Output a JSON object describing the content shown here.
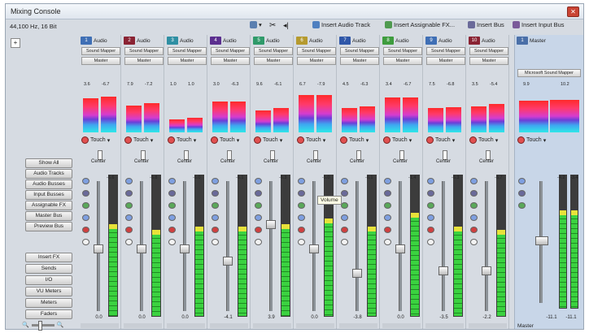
{
  "window": {
    "title": "Mixing Console",
    "format": "44,100 Hz, 16 Bit"
  },
  "toolbar": {
    "insert_audio_track": "Insert Audio Track",
    "insert_assignable_fx": "Insert Assignable FX...",
    "insert_bus": "Insert Bus",
    "insert_input_bus": "Insert Input Bus"
  },
  "left_panel": {
    "plus": "+",
    "view_buttons": [
      "Show All",
      "Audio Tracks",
      "Audio Busses",
      "Input Busses",
      "Assignable FX",
      "Master Bus",
      "Preview Bus"
    ],
    "section_buttons": [
      "Insert FX",
      "Sends",
      "I/O",
      "VU Meters",
      "Meters",
      "Faders"
    ]
  },
  "strip_defaults": {
    "send_label": "Sound Mapper",
    "output": "Master",
    "automation": "Touch",
    "pan": "Center"
  },
  "strips": [
    {
      "num": "1",
      "name": "Audio",
      "color": "#3f6fb5",
      "peak_l": "3.6",
      "peak_r": "-6.7",
      "meter_l": 0.78,
      "meter_r": 0.82,
      "fader": 0.48,
      "vu_peak": "-6.6",
      "vu": 0.62,
      "vol": "0.0"
    },
    {
      "num": "2",
      "name": "Audio",
      "color": "#8a2333",
      "peak_l": "7.9",
      "peak_r": "-7.2",
      "meter_l": 0.62,
      "meter_r": 0.66,
      "fader": 0.48,
      "vu_peak": "-6.8",
      "vu": 0.58,
      "vol": "0.0"
    },
    {
      "num": "3",
      "name": "Audio",
      "color": "#2f8fa3",
      "peak_l": "1.0",
      "peak_r": "1.0",
      "meter_l": 0.3,
      "meter_r": 0.34,
      "fader": 0.48,
      "vu_peak": "-6.0",
      "vu": 0.6,
      "vol": "0.0"
    },
    {
      "num": "4",
      "name": "Audio",
      "color": "#5b2f8f",
      "peak_l": "3.0",
      "peak_r": "-6.3",
      "meter_l": 0.7,
      "meter_r": 0.7,
      "fader": 0.38,
      "vu_peak": "-6.1",
      "vu": 0.6,
      "vol": "-4.1"
    },
    {
      "num": "5",
      "name": "Audio",
      "color": "#2f9a6a",
      "peak_l": "9.6",
      "peak_r": "-6.1",
      "meter_l": 0.5,
      "meter_r": 0.55,
      "fader": 0.68,
      "vu_peak": "-6.3",
      "vu": 0.62,
      "vol": "3.9"
    },
    {
      "num": "6",
      "name": "Audio",
      "color": "#b59a2f",
      "peak_l": "6.7",
      "peak_r": "-7.9",
      "meter_l": 0.86,
      "meter_r": 0.86,
      "fader": 0.48,
      "vu_peak": "-5.0",
      "vu": 0.66,
      "vol": "0.0"
    },
    {
      "num": "7",
      "name": "Audio",
      "color": "#2f57a8",
      "peak_l": "4.5",
      "peak_r": "-6.3",
      "meter_l": 0.55,
      "meter_r": 0.6,
      "fader": 0.28,
      "vu_peak": "-6.1",
      "vu": 0.6,
      "vol": "-3.8"
    },
    {
      "num": "8",
      "name": "Audio",
      "color": "#3e9c3e",
      "peak_l": "3.4",
      "peak_r": "-6.7",
      "meter_l": 0.8,
      "meter_r": 0.8,
      "fader": 0.48,
      "vu_peak": "-1.4",
      "vu": 0.7,
      "vol": "0.0"
    },
    {
      "num": "9",
      "name": "Audio",
      "color": "#3f6fb5",
      "peak_l": "7.5",
      "peak_r": "-6.8",
      "meter_l": 0.56,
      "meter_r": 0.58,
      "fader": 0.3,
      "vu_peak": "-6.3",
      "vu": 0.6,
      "vol": "-3.5"
    },
    {
      "num": "10",
      "name": "Audio",
      "color": "#8a2333",
      "peak_l": "3.5",
      "peak_r": "-5.4",
      "meter_l": 0.6,
      "meter_r": 0.64,
      "fader": 0.3,
      "vu_peak": "-6.7",
      "vu": 0.58,
      "vol": "-2.2"
    }
  ],
  "master": {
    "num": "1",
    "name": "Master",
    "color": "#4a6fa8",
    "send_label": "Microsoft Sound Mapper",
    "peak_l": "9.9",
    "peak_r": "10.2",
    "meter_l": 0.72,
    "meter_r": 0.74,
    "automation": "Touch",
    "fader": 0.55,
    "vu_peak_l": "-4.2",
    "vu_peak_r": "-3.4",
    "vu": 0.7,
    "vol_l": "-11.1",
    "vol_r": "-11.1",
    "footer": "Master"
  },
  "tooltip": "Volume",
  "colors": {
    "accent": "#3f6fb5",
    "meter_hot": "#ff2a2a",
    "vu_green": "#3bd240"
  }
}
